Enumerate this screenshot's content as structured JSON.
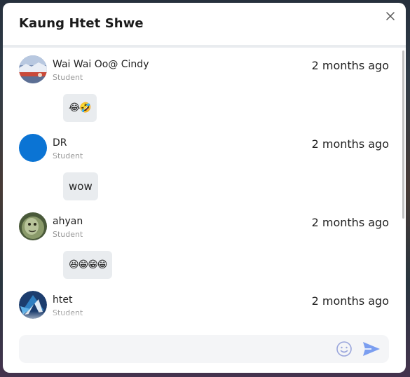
{
  "modal": {
    "title": "Kaung Htet Shwe"
  },
  "icons": {
    "close": "close-icon",
    "emoji": "smile-icon",
    "send": "send-icon"
  },
  "comments": [
    {
      "name": "Wai Wai Oo@ Cindy",
      "role": "Student",
      "time": "2 months ago",
      "message": "😂🤣",
      "avatar": "photo"
    },
    {
      "name": "DR",
      "role": "Student",
      "time": "2 months ago",
      "message": "wow",
      "avatar_color": "#0b74d4"
    },
    {
      "name": "ahyan",
      "role": "Student",
      "time": "2 months ago",
      "message": "😆😁😁😁",
      "avatar": "photo"
    },
    {
      "name": "htet",
      "role": "Student",
      "time": "2 months ago",
      "message": "",
      "avatar": "logo"
    }
  ],
  "composer": {
    "value": "",
    "placeholder": ""
  },
  "colors": {
    "accent": "#7b9ef0",
    "bubble": "#e9ecef",
    "muted": "#9a9a9a"
  }
}
